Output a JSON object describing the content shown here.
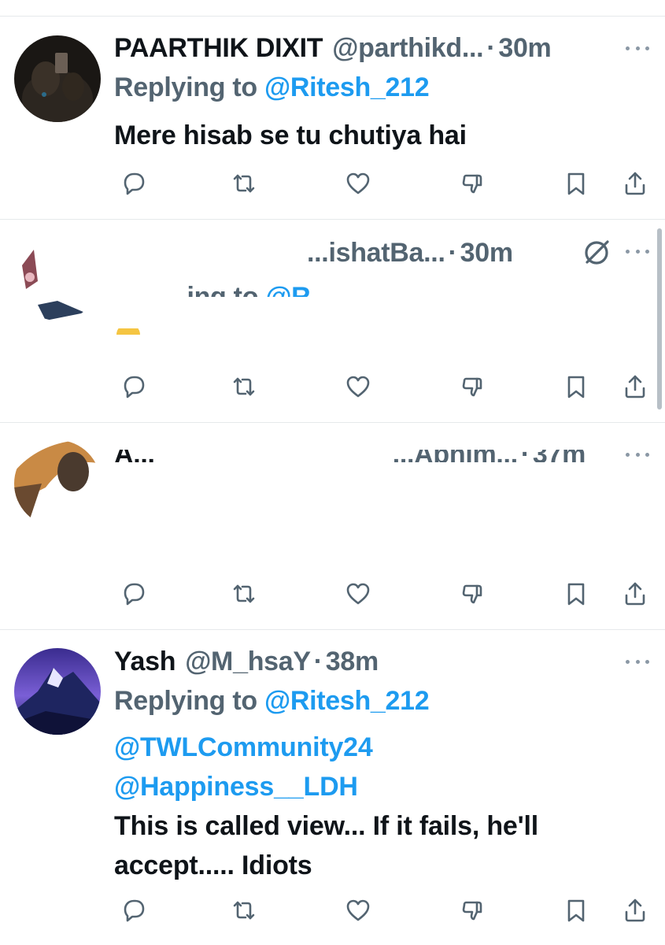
{
  "tweets": [
    {
      "name": "PAARTHIK DIXIT",
      "handle": "@parthikd...",
      "dot": "·",
      "time": "30m",
      "replying_prefix": "Replying to ",
      "replying_to": "@Ritesh_212",
      "text": "Mere hisab se tu chutiya hai"
    },
    {
      "name": "",
      "handle": "...ishatBa...",
      "dot": "·",
      "time": "30m",
      "replying_prefix": "...ing to ",
      "replying_to": "@R...",
      "text": ""
    },
    {
      "name": "A...",
      "handle": "...Abhim...",
      "dot": "·",
      "time": "37m",
      "replying_prefix": "",
      "replying_to": "",
      "text": ""
    },
    {
      "name": "Yash",
      "handle": "@M_hsaY",
      "dot": "·",
      "time": "38m",
      "replying_prefix": "Replying to ",
      "replying_to": "@Ritesh_212",
      "mention_1": "@TWLCommunity24",
      "mention_2": "@Happiness__LDH",
      "text": "This is called view... If it fails, he'll accept..... Idiots"
    }
  ],
  "icons": {
    "reply": "reply-icon",
    "retweet": "retweet-icon",
    "like": "like-icon",
    "dislike": "dislike-icon",
    "bookmark": "bookmark-icon",
    "share": "share-icon",
    "more": "more-icon",
    "mute": "mute-icon"
  },
  "colors": {
    "text": "#0f1419",
    "secondary": "#536471",
    "link": "#1d9bf0",
    "divider": "#e6e9eb"
  }
}
